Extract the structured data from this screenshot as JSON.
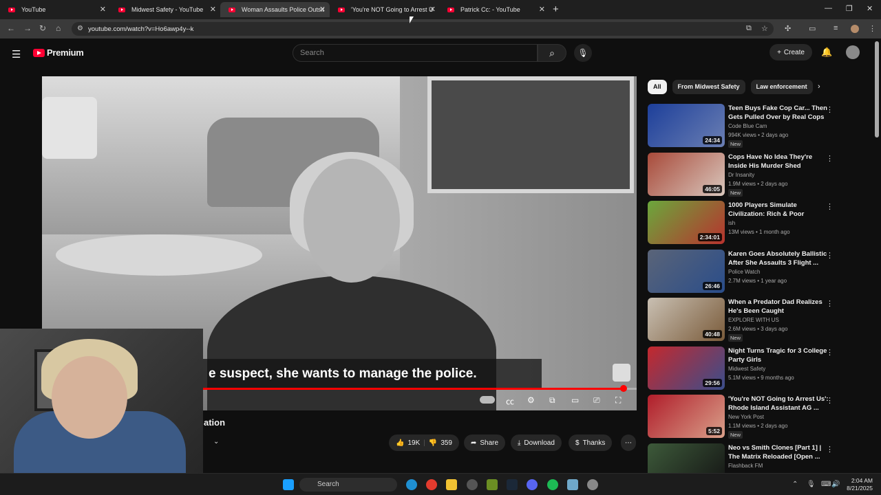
{
  "browser": {
    "tabs": [
      {
        "title": "YouTube",
        "active": false
      },
      {
        "title": "Midwest Safety - YouTube",
        "active": false
      },
      {
        "title": "Woman Assaults Police Outside",
        "active": true
      },
      {
        "title": "'You're NOT Going to Arrest Us'",
        "active": false
      },
      {
        "title": "Patrick Cc: - YouTube",
        "active": false
      }
    ],
    "url": "youtube.com/watch?v=Ho6awp4y--k"
  },
  "youtube": {
    "brand": "Premium",
    "search_placeholder": "Search",
    "create_label": "Create"
  },
  "video": {
    "caption": "e suspect, she wants to manage the police.",
    "progress_fraction": 0.97,
    "title_fragment": "ation",
    "like_count": "19K",
    "dislike_count": "359",
    "share_label": "Share",
    "download_label": "Download",
    "thanks_label": "Thanks"
  },
  "chips": [
    "All",
    "From Midwest Safety",
    "Law enforcement"
  ],
  "recommendations": [
    {
      "title": "Teen Buys Fake Cop Car... Then Gets Pulled Over by Real Cops",
      "channel": "Code Blue Cam",
      "meta": "994K views • 2 days ago",
      "badge": "New",
      "duration": "24:34",
      "colors": [
        "#1d3f9a",
        "#6b7fb3"
      ]
    },
    {
      "title": "Cops Have No Idea They're Inside His Murder Shed",
      "channel": "Dr Insanity",
      "meta": "1.9M views • 2 days ago",
      "badge": "New",
      "duration": "46:05",
      "colors": [
        "#a84a3a",
        "#d9c7bd"
      ]
    },
    {
      "title": "1000 Players Simulate Civilization: Rich & Poor",
      "channel": "ish",
      "meta": "13M views • 1 month ago",
      "badge": "",
      "duration": "2:34:01",
      "colors": [
        "#6aa83c",
        "#b8322e"
      ]
    },
    {
      "title": "Karen Goes Absolutely Ballistic After She Assaults 3 Flight ...",
      "channel": "Police Watch",
      "meta": "2.7M views • 1 year ago",
      "badge": "",
      "duration": "26:46",
      "colors": [
        "#5a6478",
        "#2a4d8a"
      ]
    },
    {
      "title": "When a Predator Dad Realizes He's Been Caught",
      "channel": "EXPLORE WITH US",
      "meta": "2.6M views • 3 days ago",
      "badge": "New",
      "duration": "40:48",
      "colors": [
        "#c9c0b3",
        "#7a5b3a"
      ]
    },
    {
      "title": "Night Turns Tragic for 3 College Party Girls",
      "channel": "Midwest Safety",
      "meta": "5.1M views • 9 months ago",
      "badge": "",
      "duration": "29:56",
      "colors": [
        "#c4282d",
        "#3a4e8c"
      ]
    },
    {
      "title": "'You're NOT Going to Arrest Us': Rhode Island Assistant AG ...",
      "channel": "New York Post",
      "meta": "1.1M views • 2 days ago",
      "badge": "New",
      "duration": "5:52",
      "colors": [
        "#b01d2a",
        "#d9a08a"
      ]
    },
    {
      "title": "Neo vs Smith Clones [Part 1] | The Matrix Reloaded [Open ...",
      "channel": "Flashback FM",
      "meta": "",
      "badge": "",
      "duration": "",
      "colors": [
        "#3d5a3a",
        "#141414"
      ]
    }
  ],
  "taskbar": {
    "search_label": "Search",
    "time": "2:04 AM",
    "date": "8/21/2025"
  }
}
